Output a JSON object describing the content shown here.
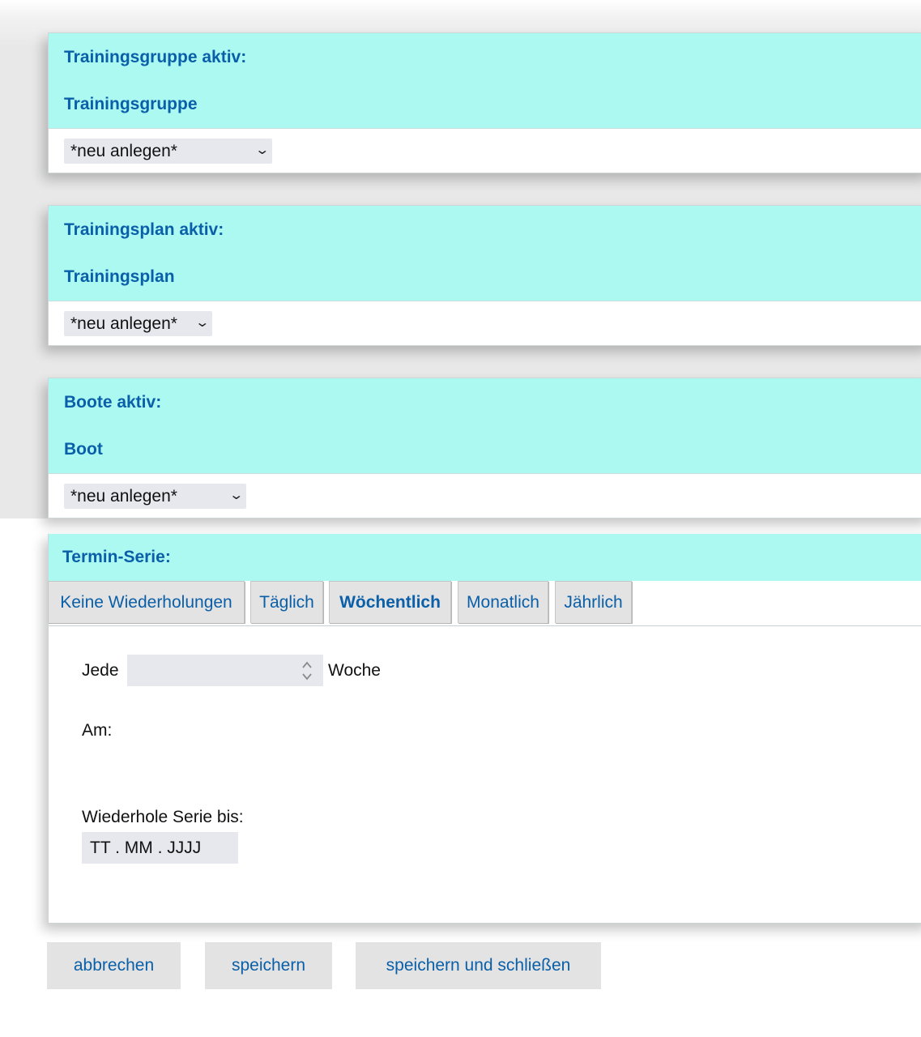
{
  "groups": [
    {
      "active_label": "Trainingsgruppe aktiv:",
      "field_label": "Trainingsgruppe",
      "select_value": "*neu anlegen*"
    },
    {
      "active_label": "Trainingsplan aktiv:",
      "field_label": "Trainingsplan",
      "select_value": "*neu anlegen*"
    },
    {
      "active_label": "Boote aktiv:",
      "field_label": "Boot",
      "select_value": "*neu anlegen*"
    }
  ],
  "series": {
    "title": "Termin-Serie:",
    "tabs": [
      "Keine Wiederholungen",
      "Täglich",
      "Wöchentlich",
      "Monatlich",
      "Jährlich"
    ],
    "active_tab": "Wöchentlich",
    "every_label": "Jede",
    "every_value": "",
    "unit_label": "Woche",
    "on_label": "Am:",
    "repeat_until_label": "Wiederhole Serie bis:",
    "date_placeholder": "TT . MM . JJJJ"
  },
  "buttons": {
    "cancel": "abbrechen",
    "save": "speichern",
    "save_close": "speichern und schließen"
  }
}
